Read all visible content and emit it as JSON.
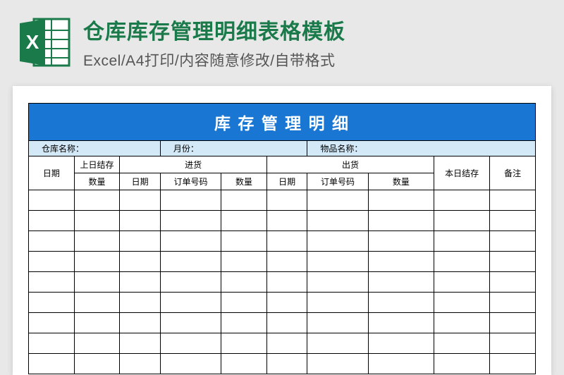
{
  "header": {
    "title": "仓库库存管理明细表格模板",
    "subtitle": "Excel/A4打印/内容随意修改/自带格式"
  },
  "sheet": {
    "title": "库 存 管 理 明 细",
    "info": {
      "warehouse_label": "仓库名称：",
      "month_label": "月份：",
      "item_label": "物品名称："
    },
    "columns": {
      "date": "日期",
      "prev_balance_line1": "上日结存",
      "prev_balance_line2": "数量",
      "inbound": "进货",
      "outbound": "出货",
      "sub_date": "日期",
      "sub_order": "订单号码",
      "sub_qty": "数量",
      "today_balance": "本日结存",
      "note": "备注"
    },
    "empty_rows": 9
  }
}
